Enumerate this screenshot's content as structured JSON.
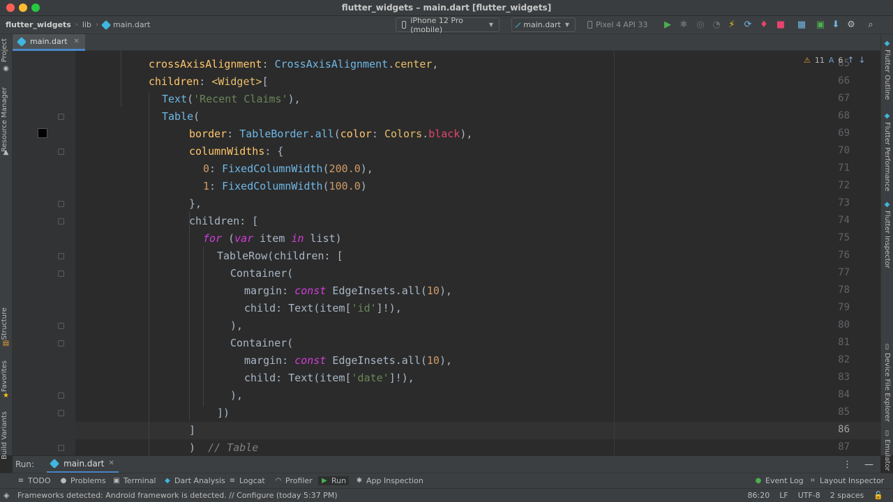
{
  "window": {
    "title": "flutter_widgets – main.dart [flutter_widgets]"
  },
  "breadcrumbs": [
    "flutter_widgets",
    "lib",
    "main.dart"
  ],
  "toolbar": {
    "device_selector": "iPhone 12 Pro (mobile)",
    "run_config": "main.dart",
    "device_name": "Pixel 4 API 33",
    "colors": {
      "run": "#4caf50",
      "hot_reload": "#f5c518",
      "stop": "#e5446e",
      "accent": "#40b6e0"
    }
  },
  "tabs": [
    {
      "label": "main.dart",
      "active": true
    }
  ],
  "left_tools": [
    "Project",
    "Resource Manager",
    "Structure",
    "Favorites",
    "Build Variants"
  ],
  "right_tools": [
    "Flutter Outline",
    "Flutter Performance",
    "Flutter Inspector",
    "Device File Explorer",
    "Emulator"
  ],
  "inspection": {
    "warnings": "11",
    "typos": "6"
  },
  "editor": {
    "current_line": "86",
    "lines": [
      {
        "n": "65",
        "parts": [
          [
            "p",
            "crossAxisAlignment"
          ],
          [
            "t",
            ": "
          ],
          [
            "c",
            "CrossAxisAlignment"
          ],
          [
            "t",
            "."
          ],
          [
            "g",
            "center"
          ],
          [
            "t",
            ","
          ]
        ]
      },
      {
        "n": "66",
        "parts": [
          [
            "p",
            "children"
          ],
          [
            "t",
            ": "
          ],
          [
            "g",
            "<Widget>"
          ],
          [
            "t",
            "["
          ]
        ]
      },
      {
        "n": "67",
        "parts": [
          [
            "c",
            "Text"
          ],
          [
            "t",
            "("
          ],
          [
            "s",
            "'Recent Claims'"
          ],
          [
            "t",
            "),"
          ]
        ]
      },
      {
        "n": "68",
        "parts": [
          [
            "c",
            "Table"
          ],
          [
            "t",
            "("
          ]
        ]
      },
      {
        "n": "69",
        "parts": [
          [
            "p",
            "border"
          ],
          [
            "t",
            ": "
          ],
          [
            "c",
            "TableBorder"
          ],
          [
            "t",
            "."
          ],
          [
            "c",
            "all"
          ],
          [
            "t",
            "("
          ],
          [
            "p",
            "color"
          ],
          [
            "t",
            ": "
          ],
          [
            "g",
            "Colors"
          ],
          [
            "t",
            "."
          ],
          [
            "k2",
            "black"
          ],
          [
            "t",
            "),"
          ]
        ]
      },
      {
        "n": "70",
        "parts": [
          [
            "p",
            "columnWidths"
          ],
          [
            "t",
            ": {"
          ]
        ]
      },
      {
        "n": "71",
        "parts": [
          [
            "n",
            "0"
          ],
          [
            "t",
            ": "
          ],
          [
            "c",
            "FixedColumnWidth"
          ],
          [
            "t",
            "("
          ],
          [
            "n",
            "200.0"
          ],
          [
            "t",
            "),"
          ]
        ]
      },
      {
        "n": "72",
        "parts": [
          [
            "n",
            "1"
          ],
          [
            "t",
            ": "
          ],
          [
            "c",
            "FixedColumnWidth"
          ],
          [
            "t",
            "("
          ],
          [
            "n",
            "100.0"
          ],
          [
            "t",
            ")"
          ]
        ]
      },
      {
        "n": "73",
        "parts": [
          [
            "t",
            "},"
          ]
        ]
      },
      {
        "n": "74",
        "parts": [
          [
            "t",
            "children: ["
          ]
        ]
      },
      {
        "n": "75",
        "parts": [
          [
            "k",
            "for"
          ],
          [
            "t",
            " ("
          ],
          [
            "k",
            "var"
          ],
          [
            "t",
            " item "
          ],
          [
            "k",
            "in"
          ],
          [
            "t",
            " list)"
          ]
        ]
      },
      {
        "n": "76",
        "parts": [
          [
            "t",
            "TableRow(children: ["
          ]
        ]
      },
      {
        "n": "77",
        "parts": [
          [
            "t",
            "Container("
          ]
        ]
      },
      {
        "n": "78",
        "parts": [
          [
            "t",
            "margin: "
          ],
          [
            "k",
            "const"
          ],
          [
            "t",
            " EdgeInsets.all("
          ],
          [
            "n",
            "10"
          ],
          [
            "t",
            "),"
          ]
        ]
      },
      {
        "n": "79",
        "parts": [
          [
            "t",
            "child: Text(item["
          ],
          [
            "s",
            "'id'"
          ],
          [
            "t",
            "]!),"
          ]
        ]
      },
      {
        "n": "80",
        "parts": [
          [
            "t",
            "),"
          ]
        ]
      },
      {
        "n": "81",
        "parts": [
          [
            "t",
            "Container("
          ]
        ]
      },
      {
        "n": "82",
        "parts": [
          [
            "t",
            "margin: "
          ],
          [
            "k",
            "const"
          ],
          [
            "t",
            " EdgeInsets.all("
          ],
          [
            "n",
            "10"
          ],
          [
            "t",
            "),"
          ]
        ]
      },
      {
        "n": "83",
        "parts": [
          [
            "t",
            "child: Text(item["
          ],
          [
            "s",
            "'date'"
          ],
          [
            "t",
            "]!),"
          ]
        ]
      },
      {
        "n": "84",
        "parts": [
          [
            "t",
            "),"
          ]
        ]
      },
      {
        "n": "85",
        "parts": [
          [
            "t",
            "])"
          ]
        ]
      },
      {
        "n": "86",
        "parts": [
          [
            "t",
            "]"
          ]
        ]
      },
      {
        "n": "87",
        "parts": [
          [
            "t",
            ")  "
          ],
          [
            "m",
            "// Table"
          ]
        ]
      }
    ]
  },
  "run_panel": {
    "label": "Run:",
    "tab": "main.dart"
  },
  "tool_windows": [
    "TODO",
    "Problems",
    "Terminal",
    "Dart Analysis",
    "Logcat",
    "Profiler",
    "Run",
    "App Inspection"
  ],
  "tool_windows_right": [
    "Event Log",
    "Layout Inspector"
  ],
  "status": {
    "message": "Frameworks detected: Android framework is detected. // Configure (today 5:37 PM)",
    "position": "86:20",
    "line_sep": "LF",
    "encoding": "UTF-8",
    "indent": "2 spaces"
  }
}
